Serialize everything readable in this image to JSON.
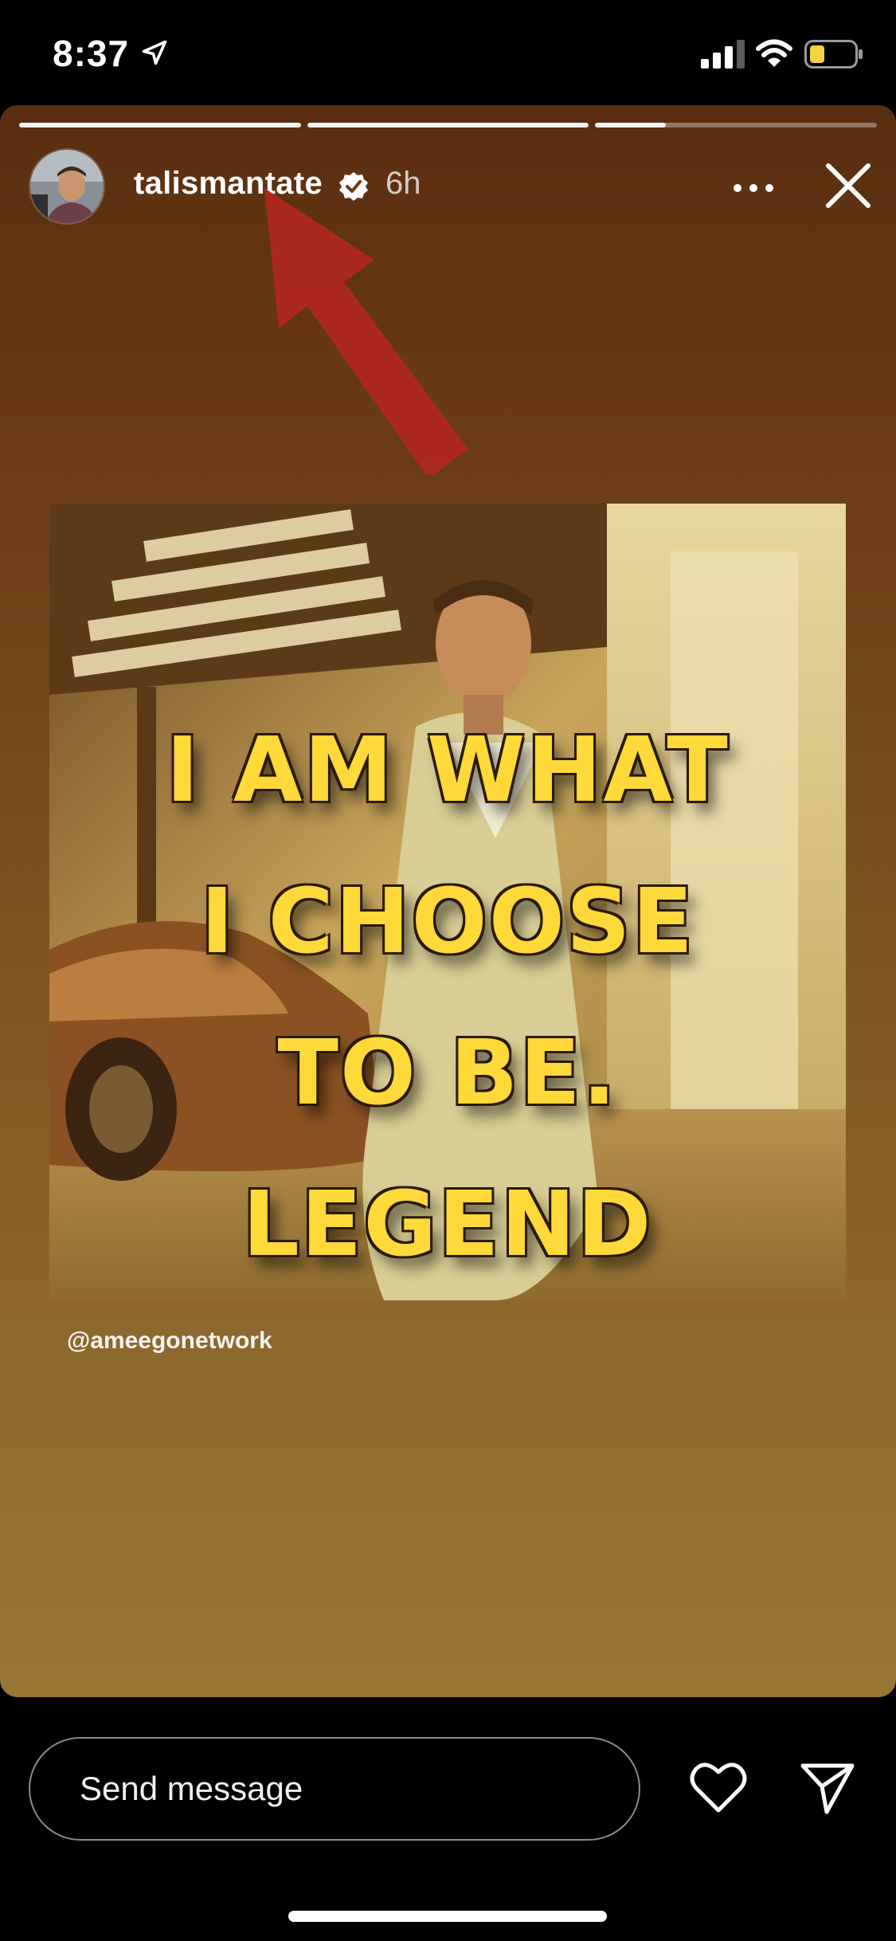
{
  "status_bar": {
    "time": "8:37",
    "location_icon": "location-arrow-icon",
    "signal_icon": "cellular-signal-icon",
    "wifi_icon": "wifi-icon",
    "battery_icon": "battery-low-icon",
    "battery_color": "#f5d33f"
  },
  "story": {
    "progress": [
      1.0,
      1.0,
      0.25
    ],
    "username": "talismantate",
    "verified": true,
    "time_ago": "6h",
    "more_icon": "ellipsis-icon",
    "close_icon": "close-icon",
    "annotation_color": "#b3261e",
    "quote_lines": [
      "I AM WHAT",
      "I CHOOSE",
      "TO BE.",
      "LEGEND"
    ],
    "quote_color": "#ffd83a",
    "image_credit": "@ameegonetwork"
  },
  "reply_bar": {
    "placeholder": "Send message",
    "like_icon": "heart-icon",
    "share_icon": "send-icon"
  }
}
